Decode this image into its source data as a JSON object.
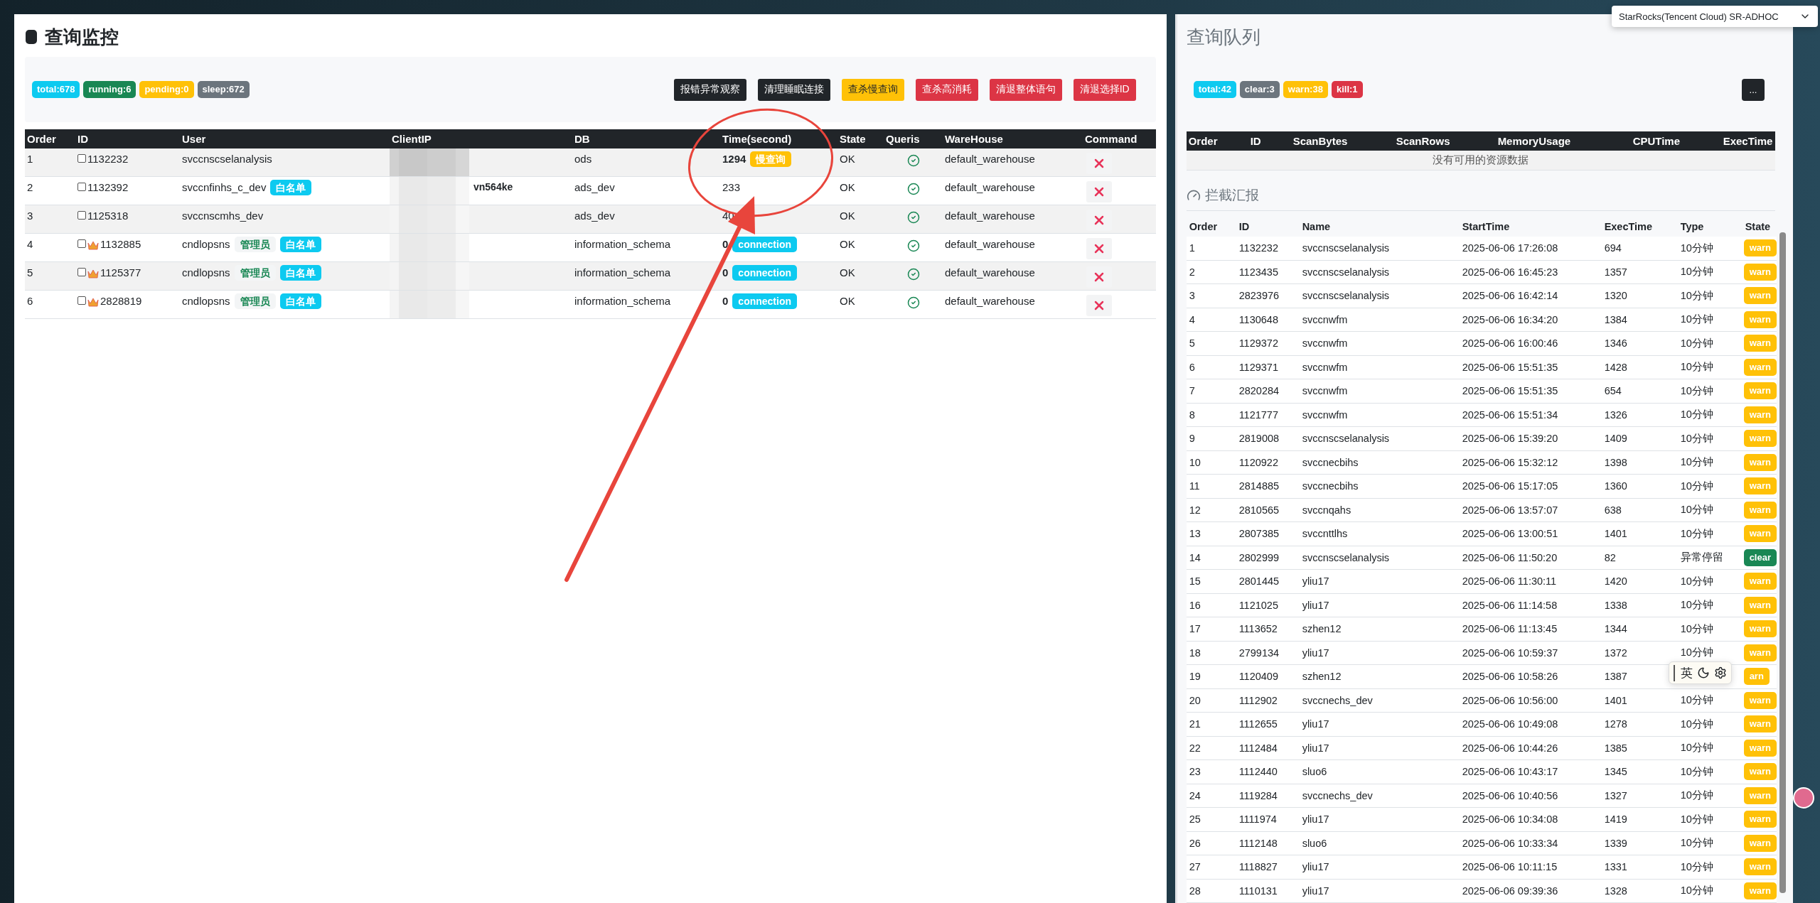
{
  "cluster_select": {
    "value": "StarRocks(Tencent Cloud) SR-ADHOC"
  },
  "monitor": {
    "title": "查询监控",
    "stats": [
      {
        "label": "total:678",
        "kind": "info"
      },
      {
        "label": "running:6",
        "kind": "success"
      },
      {
        "label": "pending:0",
        "kind": "warning"
      },
      {
        "label": "sleep:672",
        "kind": "secondary"
      }
    ],
    "actions": [
      {
        "label": "报错异常观察",
        "kind": "dark"
      },
      {
        "label": "清理睡眠连接",
        "kind": "dark"
      },
      {
        "label": "查杀慢查询",
        "kind": "warning"
      },
      {
        "label": "查杀高消耗",
        "kind": "danger"
      },
      {
        "label": "清退整体语句",
        "kind": "danger"
      },
      {
        "label": "清退选择ID",
        "kind": "danger"
      }
    ],
    "table": {
      "columns": [
        "Order",
        "ID",
        "User",
        "ClientIP",
        "DB",
        "Time(second)",
        "State",
        "Queris",
        "WareHouse",
        "Command"
      ],
      "rows": [
        {
          "order": "1",
          "id": "1132232",
          "checked": false,
          "admin": false,
          "user": "svccnscselanalysis",
          "tags": [],
          "db": "ods",
          "time": "1294",
          "time_tag": {
            "label": "慢查询",
            "kind": "warning"
          },
          "state": "OK",
          "ok": true,
          "warehouse": "default_warehouse"
        },
        {
          "order": "2",
          "id": "1132392",
          "checked": false,
          "admin": false,
          "user": "svccnfinhs_c_dev",
          "tags": [
            {
              "label": "白名单",
              "kind": "info"
            }
          ],
          "client_ip": "vn564ke",
          "db": "ads_dev",
          "time": "233",
          "state": "OK",
          "ok": true,
          "warehouse": "default_warehouse"
        },
        {
          "order": "3",
          "id": "1125318",
          "checked": false,
          "admin": false,
          "user": "svccnscmhs_dev",
          "tags": [],
          "db": "ads_dev",
          "time": "40",
          "state": "OK",
          "ok": true,
          "warehouse": "default_warehouse"
        },
        {
          "order": "4",
          "id": "1132885",
          "checked": false,
          "admin": true,
          "user": "cndlopsns",
          "tags": [
            {
              "label": "管理员",
              "kind": "admin"
            },
            {
              "label": "白名单",
              "kind": "info"
            }
          ],
          "db": "information_schema",
          "time": "0",
          "time_tag": {
            "label": "connection",
            "kind": "info"
          },
          "state": "OK",
          "ok": true,
          "warehouse": "default_warehouse"
        },
        {
          "order": "5",
          "id": "1125377",
          "checked": false,
          "admin": true,
          "user": "cndlopsns",
          "tags": [
            {
              "label": "管理员",
              "kind": "admin"
            },
            {
              "label": "白名单",
              "kind": "info"
            }
          ],
          "db": "information_schema",
          "time": "0",
          "time_tag": {
            "label": "connection",
            "kind": "info"
          },
          "state": "OK",
          "ok": true,
          "warehouse": "default_warehouse"
        },
        {
          "order": "6",
          "id": "2828819",
          "checked": false,
          "admin": true,
          "user": "cndlopsns",
          "tags": [
            {
              "label": "管理员",
              "kind": "admin"
            },
            {
              "label": "白名单",
              "kind": "info"
            }
          ],
          "db": "information_schema",
          "time": "0",
          "time_tag": {
            "label": "connection",
            "kind": "info"
          },
          "state": "OK",
          "ok": true,
          "warehouse": "default_warehouse"
        }
      ]
    }
  },
  "queue": {
    "title": "查询队列",
    "stats": [
      {
        "label": "total:42",
        "kind": "info"
      },
      {
        "label": "clear:3",
        "kind": "secondary"
      },
      {
        "label": "warn:38",
        "kind": "warning"
      },
      {
        "label": "kill:1",
        "kind": "danger"
      }
    ],
    "more_button": "...",
    "columns": [
      "Order",
      "ID",
      "ScanBytes",
      "ScanRows",
      "MemoryUsage",
      "CPUTime",
      "ExecTime"
    ],
    "empty_text": "没有可用的资源数据"
  },
  "report": {
    "title": "拦截汇报",
    "columns": [
      "Order",
      "ID",
      "Name",
      "StartTime",
      "ExecTime",
      "Type",
      "State"
    ],
    "rows": [
      {
        "order": "1",
        "id": "1132232",
        "name": "svccnscselanalysis",
        "start": "2025-06-06 17:26:08",
        "exec": "694",
        "type": "10分钟",
        "state": "warn",
        "kind": "warning"
      },
      {
        "order": "2",
        "id": "1123435",
        "name": "svccnscselanalysis",
        "start": "2025-06-06 16:45:23",
        "exec": "1357",
        "type": "10分钟",
        "state": "warn",
        "kind": "warning"
      },
      {
        "order": "3",
        "id": "2823976",
        "name": "svccnscselanalysis",
        "start": "2025-06-06 16:42:14",
        "exec": "1320",
        "type": "10分钟",
        "state": "warn",
        "kind": "warning"
      },
      {
        "order": "4",
        "id": "1130648",
        "name": "svccnwfm",
        "start": "2025-06-06 16:34:20",
        "exec": "1384",
        "type": "10分钟",
        "state": "warn",
        "kind": "warning"
      },
      {
        "order": "5",
        "id": "1129372",
        "name": "svccnwfm",
        "start": "2025-06-06 16:00:46",
        "exec": "1346",
        "type": "10分钟",
        "state": "warn",
        "kind": "warning"
      },
      {
        "order": "6",
        "id": "1129371",
        "name": "svccnwfm",
        "start": "2025-06-06 15:51:35",
        "exec": "1428",
        "type": "10分钟",
        "state": "warn",
        "kind": "warning"
      },
      {
        "order": "7",
        "id": "2820284",
        "name": "svccnwfm",
        "start": "2025-06-06 15:51:35",
        "exec": "654",
        "type": "10分钟",
        "state": "warn",
        "kind": "warning"
      },
      {
        "order": "8",
        "id": "1121777",
        "name": "svccnwfm",
        "start": "2025-06-06 15:51:34",
        "exec": "1326",
        "type": "10分钟",
        "state": "warn",
        "kind": "warning"
      },
      {
        "order": "9",
        "id": "2819008",
        "name": "svccnscselanalysis",
        "start": "2025-06-06 15:39:20",
        "exec": "1409",
        "type": "10分钟",
        "state": "warn",
        "kind": "warning"
      },
      {
        "order": "10",
        "id": "1120922",
        "name": "svccnecbihs",
        "start": "2025-06-06 15:32:12",
        "exec": "1398",
        "type": "10分钟",
        "state": "warn",
        "kind": "warning"
      },
      {
        "order": "11",
        "id": "2814885",
        "name": "svccnecbihs",
        "start": "2025-06-06 15:17:05",
        "exec": "1360",
        "type": "10分钟",
        "state": "warn",
        "kind": "warning"
      },
      {
        "order": "12",
        "id": "2810565",
        "name": "svccnqahs",
        "start": "2025-06-06 13:57:07",
        "exec": "638",
        "type": "10分钟",
        "state": "warn",
        "kind": "warning"
      },
      {
        "order": "13",
        "id": "2807385",
        "name": "svccnttlhs",
        "start": "2025-06-06 13:00:51",
        "exec": "1401",
        "type": "10分钟",
        "state": "warn",
        "kind": "warning"
      },
      {
        "order": "14",
        "id": "2802999",
        "name": "svccnscselanalysis",
        "start": "2025-06-06 11:50:20",
        "exec": "82",
        "type": "异常停留",
        "state": "clear",
        "kind": "success"
      },
      {
        "order": "15",
        "id": "2801445",
        "name": "yliu17",
        "start": "2025-06-06 11:30:11",
        "exec": "1420",
        "type": "10分钟",
        "state": "warn",
        "kind": "warning"
      },
      {
        "order": "16",
        "id": "1121025",
        "name": "yliu17",
        "start": "2025-06-06 11:14:58",
        "exec": "1338",
        "type": "10分钟",
        "state": "warn",
        "kind": "warning"
      },
      {
        "order": "17",
        "id": "1113652",
        "name": "szhen12",
        "start": "2025-06-06 11:13:45",
        "exec": "1344",
        "type": "10分钟",
        "state": "warn",
        "kind": "warning"
      },
      {
        "order": "18",
        "id": "2799134",
        "name": "yliu17",
        "start": "2025-06-06 10:59:37",
        "exec": "1372",
        "type": "10分钟",
        "state": "warn",
        "kind": "warning"
      },
      {
        "order": "19",
        "id": "1120409",
        "name": "szhen12",
        "start": "2025-06-06 10:58:26",
        "exec": "1387",
        "state": "arn",
        "kind": "warning"
      },
      {
        "order": "20",
        "id": "1112902",
        "name": "svccnechs_dev",
        "start": "2025-06-06 10:56:00",
        "exec": "1401",
        "type": "10分钟",
        "state": "warn",
        "kind": "warning"
      },
      {
        "order": "21",
        "id": "1112655",
        "name": "yliu17",
        "start": "2025-06-06 10:49:08",
        "exec": "1278",
        "type": "10分钟",
        "state": "warn",
        "kind": "warning"
      },
      {
        "order": "22",
        "id": "1112484",
        "name": "yliu17",
        "start": "2025-06-06 10:44:26",
        "exec": "1385",
        "type": "10分钟",
        "state": "warn",
        "kind": "warning"
      },
      {
        "order": "23",
        "id": "1112440",
        "name": "sluo6",
        "start": "2025-06-06 10:43:17",
        "exec": "1345",
        "type": "10分钟",
        "state": "warn",
        "kind": "warning"
      },
      {
        "order": "24",
        "id": "1119284",
        "name": "svccnechs_dev",
        "start": "2025-06-06 10:40:56",
        "exec": "1327",
        "type": "10分钟",
        "state": "warn",
        "kind": "warning"
      },
      {
        "order": "25",
        "id": "1111974",
        "name": "yliu17",
        "start": "2025-06-06 10:34:08",
        "exec": "1419",
        "type": "10分钟",
        "state": "warn",
        "kind": "warning"
      },
      {
        "order": "26",
        "id": "1112148",
        "name": "sluo6",
        "start": "2025-06-06 10:33:34",
        "exec": "1339",
        "type": "10分钟",
        "state": "warn",
        "kind": "warning"
      },
      {
        "order": "27",
        "id": "1118827",
        "name": "yliu17",
        "start": "2025-06-06 10:11:15",
        "exec": "1331",
        "type": "10分钟",
        "state": "warn",
        "kind": "warning"
      },
      {
        "order": "28",
        "id": "1110131",
        "name": "yliu17",
        "start": "2025-06-06 09:39:36",
        "exec": "1328",
        "type": "10分钟",
        "state": "warn",
        "kind": "warning"
      }
    ]
  },
  "ime_toolbar": {
    "label": "英"
  }
}
